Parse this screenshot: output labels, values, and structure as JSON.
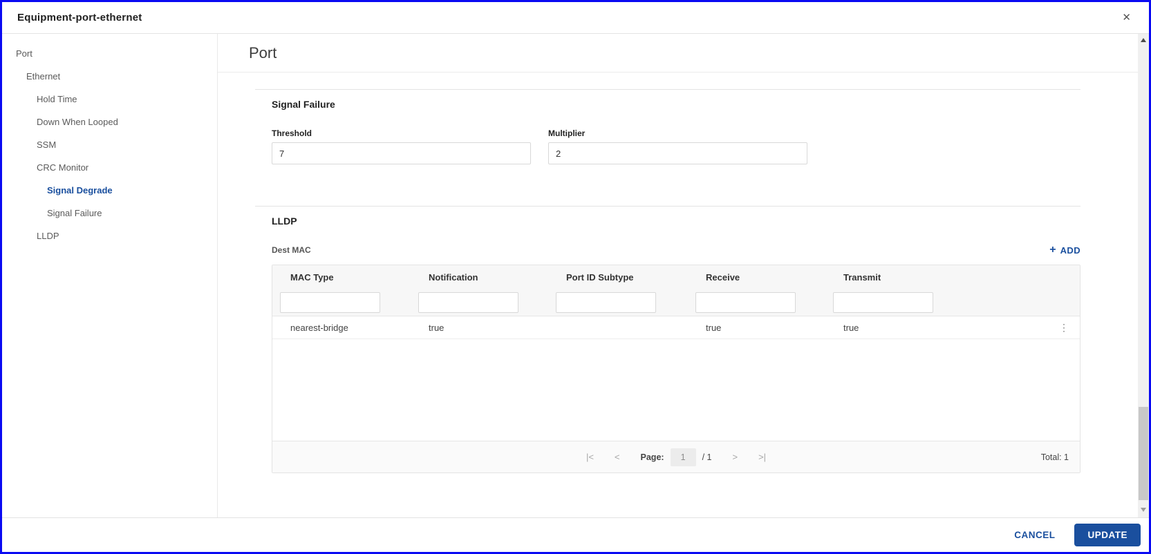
{
  "colors": {
    "accent": "#1a4f9e",
    "window_border": "#0a0af2"
  },
  "window": {
    "title": "Equipment-port-ethernet",
    "close_glyph": "✕"
  },
  "sidebar": {
    "items": [
      {
        "label": "Port",
        "level": 0,
        "selected": false
      },
      {
        "label": "Ethernet",
        "level": 1,
        "selected": false
      },
      {
        "label": "Hold Time",
        "level": 2,
        "selected": false
      },
      {
        "label": "Down When Looped",
        "level": 2,
        "selected": false
      },
      {
        "label": "SSM",
        "level": 2,
        "selected": false
      },
      {
        "label": "CRC Monitor",
        "level": 2,
        "selected": false
      },
      {
        "label": "Signal Degrade",
        "level": 3,
        "selected": true
      },
      {
        "label": "Signal Failure",
        "level": 3,
        "selected": false
      },
      {
        "label": "LLDP",
        "level": 2,
        "selected": false
      }
    ]
  },
  "content": {
    "page_title": "Port"
  },
  "signal_failure": {
    "title": "Signal Failure",
    "fields": [
      {
        "label": "Threshold",
        "value": "7"
      },
      {
        "label": "Multiplier",
        "value": "2"
      }
    ]
  },
  "lldp": {
    "title": "LLDP",
    "dest_mac_label": "Dest MAC",
    "add_icon_glyph": "+",
    "add_label": "ADD"
  },
  "table": {
    "columns": [
      "MAC Type",
      "Notification",
      "Port ID Subtype",
      "Receive",
      "Transmit"
    ],
    "rows": [
      {
        "cells": [
          "nearest-bridge",
          "true",
          "",
          "true",
          "true"
        ]
      }
    ],
    "kebab_glyph": "⋮",
    "pagination": {
      "first_icon": "|<",
      "prev_icon": "<",
      "page_label": "Page:",
      "page_value": "1",
      "page_total": "/ 1",
      "next_icon": ">",
      "last_icon": ">|",
      "total_label": "Total: 1"
    }
  },
  "footer": {
    "cancel_label": "CANCEL",
    "update_label": "UPDATE"
  }
}
